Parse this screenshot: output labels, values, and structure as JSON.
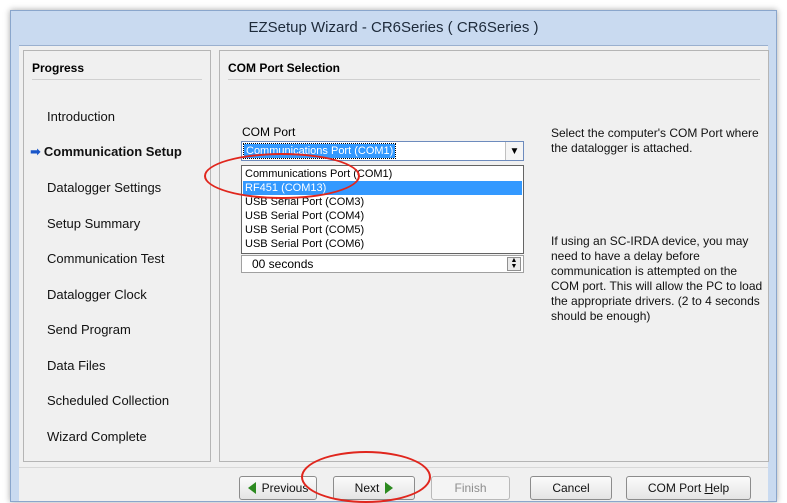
{
  "window": {
    "title": "EZSetup Wizard - CR6Series ( CR6Series )"
  },
  "progress": {
    "header": "Progress",
    "current_marker_icon": "arrow-right-icon",
    "steps": [
      {
        "label": "Introduction",
        "current": false
      },
      {
        "label": "Communication Setup",
        "current": true
      },
      {
        "label": "Datalogger Settings",
        "current": false
      },
      {
        "label": "Setup Summary",
        "current": false
      },
      {
        "label": "Communication Test",
        "current": false
      },
      {
        "label": "Datalogger Clock",
        "current": false
      },
      {
        "label": "Send Program",
        "current": false
      },
      {
        "label": "Data Files",
        "current": false
      },
      {
        "label": "Scheduled Collection",
        "current": false
      },
      {
        "label": "Wizard Complete",
        "current": false
      }
    ]
  },
  "main": {
    "header": "COM Port Selection",
    "com_port_label": "COM Port",
    "com_port_value": "Communications Port (COM1)",
    "com_port_options": [
      "Communications Port (COM1)",
      "RF451 (COM13)",
      "USB Serial Port (COM3)",
      "USB Serial Port (COM4)",
      "USB Serial Port (COM5)",
      "USB Serial Port (COM6)"
    ],
    "highlighted_option": "RF451 (COM13)",
    "delay_value": "00 seconds",
    "help_com_port": "Select the computer's COM Port where the datalogger is attached.",
    "help_irda": "If using an SC-IRDA device, you may need to have a delay before communication is attempted on the COM port.  This will allow the PC to load the appropriate drivers.  (2 to 4 seconds should be enough)"
  },
  "buttons": {
    "previous": "Previous",
    "next": "Next",
    "finish": "Finish",
    "cancel": "Cancel",
    "com_port_help_prefix": "COM Port ",
    "com_port_help_underlined": "H",
    "com_port_help_suffix": "elp"
  },
  "colors": {
    "accent_selection": "#3399ff",
    "annotation_red": "#e0261d",
    "nav_arrow_green": "#2c8a20",
    "current_step_arrow": "#1a56c9"
  }
}
